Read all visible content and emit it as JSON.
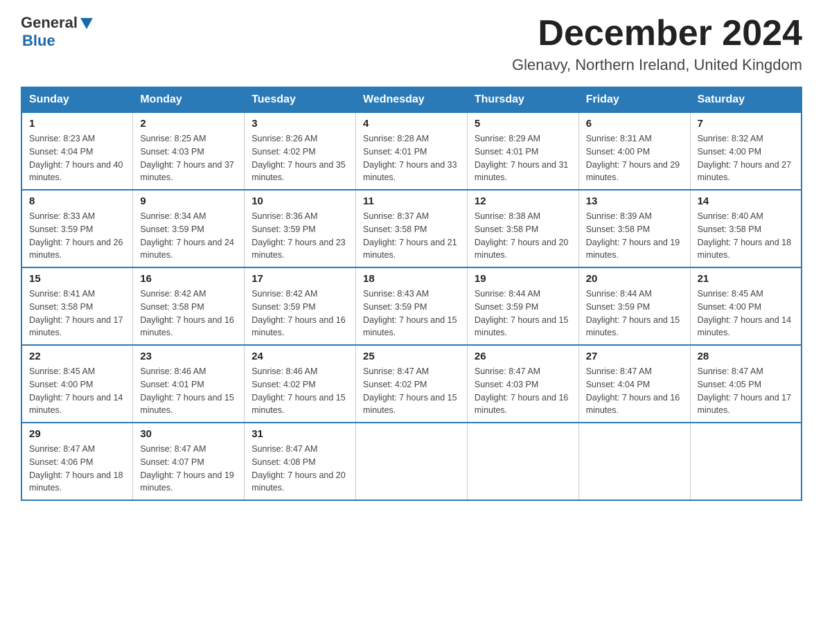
{
  "header": {
    "title": "December 2024",
    "subtitle": "Glenavy, Northern Ireland, United Kingdom",
    "logo_general": "General",
    "logo_blue": "Blue"
  },
  "calendar": {
    "days_of_week": [
      "Sunday",
      "Monday",
      "Tuesday",
      "Wednesday",
      "Thursday",
      "Friday",
      "Saturday"
    ],
    "weeks": [
      [
        {
          "day": "1",
          "sunrise": "8:23 AM",
          "sunset": "4:04 PM",
          "daylight": "7 hours and 40 minutes."
        },
        {
          "day": "2",
          "sunrise": "8:25 AM",
          "sunset": "4:03 PM",
          "daylight": "7 hours and 37 minutes."
        },
        {
          "day": "3",
          "sunrise": "8:26 AM",
          "sunset": "4:02 PM",
          "daylight": "7 hours and 35 minutes."
        },
        {
          "day": "4",
          "sunrise": "8:28 AM",
          "sunset": "4:01 PM",
          "daylight": "7 hours and 33 minutes."
        },
        {
          "day": "5",
          "sunrise": "8:29 AM",
          "sunset": "4:01 PM",
          "daylight": "7 hours and 31 minutes."
        },
        {
          "day": "6",
          "sunrise": "8:31 AM",
          "sunset": "4:00 PM",
          "daylight": "7 hours and 29 minutes."
        },
        {
          "day": "7",
          "sunrise": "8:32 AM",
          "sunset": "4:00 PM",
          "daylight": "7 hours and 27 minutes."
        }
      ],
      [
        {
          "day": "8",
          "sunrise": "8:33 AM",
          "sunset": "3:59 PM",
          "daylight": "7 hours and 26 minutes."
        },
        {
          "day": "9",
          "sunrise": "8:34 AM",
          "sunset": "3:59 PM",
          "daylight": "7 hours and 24 minutes."
        },
        {
          "day": "10",
          "sunrise": "8:36 AM",
          "sunset": "3:59 PM",
          "daylight": "7 hours and 23 minutes."
        },
        {
          "day": "11",
          "sunrise": "8:37 AM",
          "sunset": "3:58 PM",
          "daylight": "7 hours and 21 minutes."
        },
        {
          "day": "12",
          "sunrise": "8:38 AM",
          "sunset": "3:58 PM",
          "daylight": "7 hours and 20 minutes."
        },
        {
          "day": "13",
          "sunrise": "8:39 AM",
          "sunset": "3:58 PM",
          "daylight": "7 hours and 19 minutes."
        },
        {
          "day": "14",
          "sunrise": "8:40 AM",
          "sunset": "3:58 PM",
          "daylight": "7 hours and 18 minutes."
        }
      ],
      [
        {
          "day": "15",
          "sunrise": "8:41 AM",
          "sunset": "3:58 PM",
          "daylight": "7 hours and 17 minutes."
        },
        {
          "day": "16",
          "sunrise": "8:42 AM",
          "sunset": "3:58 PM",
          "daylight": "7 hours and 16 minutes."
        },
        {
          "day": "17",
          "sunrise": "8:42 AM",
          "sunset": "3:59 PM",
          "daylight": "7 hours and 16 minutes."
        },
        {
          "day": "18",
          "sunrise": "8:43 AM",
          "sunset": "3:59 PM",
          "daylight": "7 hours and 15 minutes."
        },
        {
          "day": "19",
          "sunrise": "8:44 AM",
          "sunset": "3:59 PM",
          "daylight": "7 hours and 15 minutes."
        },
        {
          "day": "20",
          "sunrise": "8:44 AM",
          "sunset": "3:59 PM",
          "daylight": "7 hours and 15 minutes."
        },
        {
          "day": "21",
          "sunrise": "8:45 AM",
          "sunset": "4:00 PM",
          "daylight": "7 hours and 14 minutes."
        }
      ],
      [
        {
          "day": "22",
          "sunrise": "8:45 AM",
          "sunset": "4:00 PM",
          "daylight": "7 hours and 14 minutes."
        },
        {
          "day": "23",
          "sunrise": "8:46 AM",
          "sunset": "4:01 PM",
          "daylight": "7 hours and 15 minutes."
        },
        {
          "day": "24",
          "sunrise": "8:46 AM",
          "sunset": "4:02 PM",
          "daylight": "7 hours and 15 minutes."
        },
        {
          "day": "25",
          "sunrise": "8:47 AM",
          "sunset": "4:02 PM",
          "daylight": "7 hours and 15 minutes."
        },
        {
          "day": "26",
          "sunrise": "8:47 AM",
          "sunset": "4:03 PM",
          "daylight": "7 hours and 16 minutes."
        },
        {
          "day": "27",
          "sunrise": "8:47 AM",
          "sunset": "4:04 PM",
          "daylight": "7 hours and 16 minutes."
        },
        {
          "day": "28",
          "sunrise": "8:47 AM",
          "sunset": "4:05 PM",
          "daylight": "7 hours and 17 minutes."
        }
      ],
      [
        {
          "day": "29",
          "sunrise": "8:47 AM",
          "sunset": "4:06 PM",
          "daylight": "7 hours and 18 minutes."
        },
        {
          "day": "30",
          "sunrise": "8:47 AM",
          "sunset": "4:07 PM",
          "daylight": "7 hours and 19 minutes."
        },
        {
          "day": "31",
          "sunrise": "8:47 AM",
          "sunset": "4:08 PM",
          "daylight": "7 hours and 20 minutes."
        },
        null,
        null,
        null,
        null
      ]
    ]
  }
}
